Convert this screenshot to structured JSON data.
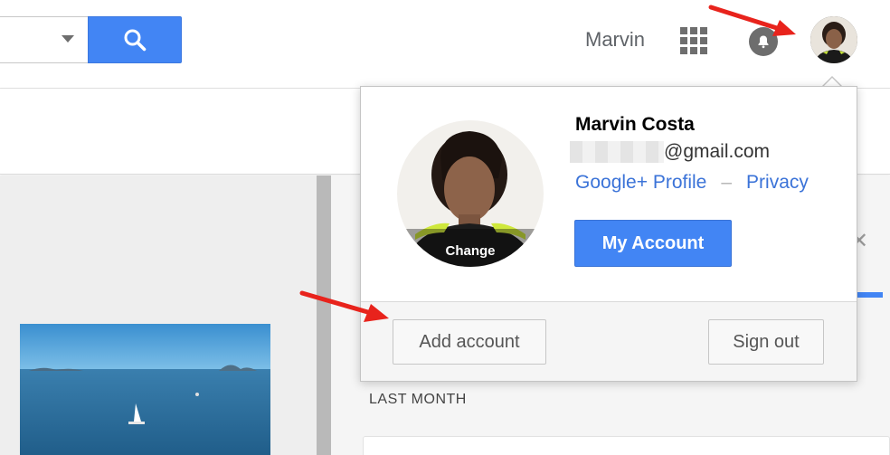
{
  "header": {
    "user_short_name": "Marvin",
    "search_icon": "search-icon",
    "apps_icon": "apps-grid-icon",
    "notifications_icon": "bell-icon"
  },
  "account_popup": {
    "change_label": "Change",
    "full_name": "Marvin Costa",
    "email_domain": "@gmail.com",
    "links": {
      "profile": "Google+ Profile",
      "separator": "–",
      "privacy": "Privacy"
    },
    "my_account_button": "My Account",
    "add_account_button": "Add account",
    "sign_out_button": "Sign out"
  },
  "content": {
    "section_label": "LAST MONTH"
  },
  "colors": {
    "primary_blue": "#4285f4",
    "link_blue": "#3b73d8",
    "annotation_red": "#e8231c"
  }
}
